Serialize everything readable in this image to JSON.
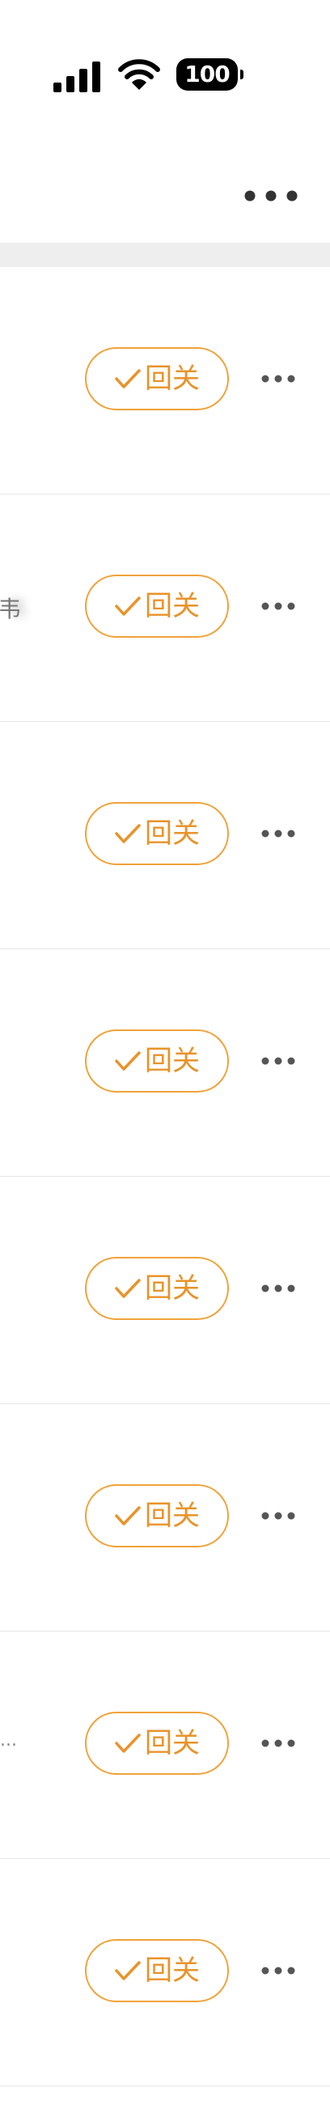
{
  "status_bar": {
    "battery": "100",
    "icons": [
      "signal-icon",
      "wifi-icon",
      "battery-icon"
    ]
  },
  "nav_bar": {
    "icons": [
      "more-icon"
    ]
  },
  "list": {
    "rows": [
      {
        "button_label": "回关",
        "fragment": ""
      },
      {
        "button_label": "回关",
        "fragment": "韦"
      },
      {
        "button_label": "回关",
        "fragment": ""
      },
      {
        "button_label": "回关",
        "fragment": ""
      },
      {
        "button_label": "回关",
        "fragment": ""
      },
      {
        "button_label": "回关",
        "fragment": ""
      },
      {
        "button_label": "回关",
        "fragment": "..."
      },
      {
        "button_label": "回关",
        "fragment": ""
      }
    ]
  },
  "colors": {
    "accent": "#e8932a",
    "separator": "#eeeeee",
    "divider": "#e6e6e6"
  }
}
